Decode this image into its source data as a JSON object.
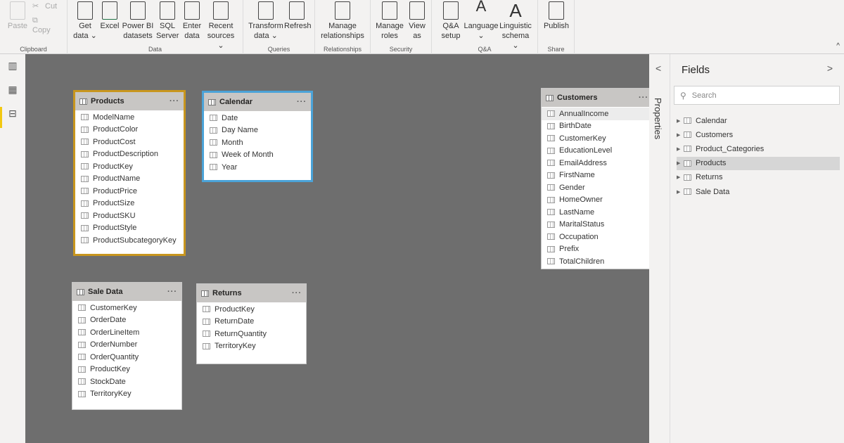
{
  "ribbon": {
    "groups": [
      {
        "label": "Clipboard",
        "buttons": [
          {
            "label": "Paste",
            "disabled": true,
            "icon": "paste-icon"
          },
          {
            "label": "Cut",
            "disabled": true,
            "icon": "scissors-icon"
          },
          {
            "label": "Copy",
            "disabled": true,
            "icon": "copy-icon"
          }
        ]
      },
      {
        "label": "Data",
        "buttons": [
          {
            "label": "Get data ⌄",
            "icon": "database-icon"
          },
          {
            "label": "Excel",
            "icon": "excel-icon"
          },
          {
            "label": "Power BI datasets",
            "icon": "dataset-icon"
          },
          {
            "label": "SQL Server",
            "icon": "sql-server-icon"
          },
          {
            "label": "Enter data",
            "icon": "table-add-icon"
          },
          {
            "label": "Recent sources ⌄",
            "icon": "clock-file-icon"
          }
        ]
      },
      {
        "label": "Queries",
        "buttons": [
          {
            "label": "Transform data ⌄",
            "icon": "transform-icon"
          },
          {
            "label": "Refresh",
            "icon": "refresh-icon"
          }
        ]
      },
      {
        "label": "Relationships",
        "buttons": [
          {
            "label": "Manage relationships",
            "icon": "relationships-icon"
          }
        ]
      },
      {
        "label": "Security",
        "buttons": [
          {
            "label": "Manage roles",
            "icon": "user-key-icon"
          },
          {
            "label": "View as",
            "icon": "user-view-icon"
          }
        ]
      },
      {
        "label": "Q&A",
        "buttons": [
          {
            "label": "Q&A setup",
            "icon": "chat-gear-icon"
          },
          {
            "label": "Language ⌄",
            "icon": "language-icon"
          },
          {
            "label": "Linguistic schema ⌄",
            "icon": "letter-a-icon"
          }
        ]
      },
      {
        "label": "Share",
        "buttons": [
          {
            "label": "Publish",
            "icon": "publish-icon"
          }
        ]
      }
    ]
  },
  "tables": [
    {
      "name": "Products",
      "border": "#c8961e",
      "fields": [
        "ModelName",
        "ProductColor",
        "ProductCost",
        "ProductDescription",
        "ProductKey",
        "ProductName",
        "ProductPrice",
        "ProductSize",
        "ProductSKU",
        "ProductStyle",
        "ProductSubcategoryKey"
      ]
    },
    {
      "name": "Calendar",
      "border": "#4ba3d8",
      "fields": [
        "Date",
        "Day Name",
        "Month",
        "Week of Month",
        "Year"
      ]
    },
    {
      "name": "Customers",
      "border": "#c8c8c8",
      "fields": [
        "AnnualIncome",
        "BirthDate",
        "CustomerKey",
        "EducationLevel",
        "EmailAddress",
        "FirstName",
        "Gender",
        "HomeOwner",
        "LastName",
        "MaritalStatus",
        "Occupation",
        "Prefix",
        "TotalChildren"
      ]
    },
    {
      "name": "Sale Data",
      "border": "#c8c8c8",
      "fields": [
        "CustomerKey",
        "OrderDate",
        "OrderLineItem",
        "OrderNumber",
        "OrderQuantity",
        "ProductKey",
        "StockDate",
        "TerritoryKey"
      ]
    },
    {
      "name": "Returns",
      "border": "#c8c8c8",
      "fields": [
        "ProductKey",
        "ReturnDate",
        "ReturnQuantity",
        "TerritoryKey"
      ]
    }
  ],
  "more_label": "···",
  "properties": {
    "label": "Properties"
  },
  "fields_pane": {
    "title": "Fields",
    "search_placeholder": "Search",
    "items": [
      "Calendar",
      "Customers",
      "Product_Categories",
      "Products",
      "Returns",
      "Sale Data"
    ],
    "selected": "Products"
  }
}
